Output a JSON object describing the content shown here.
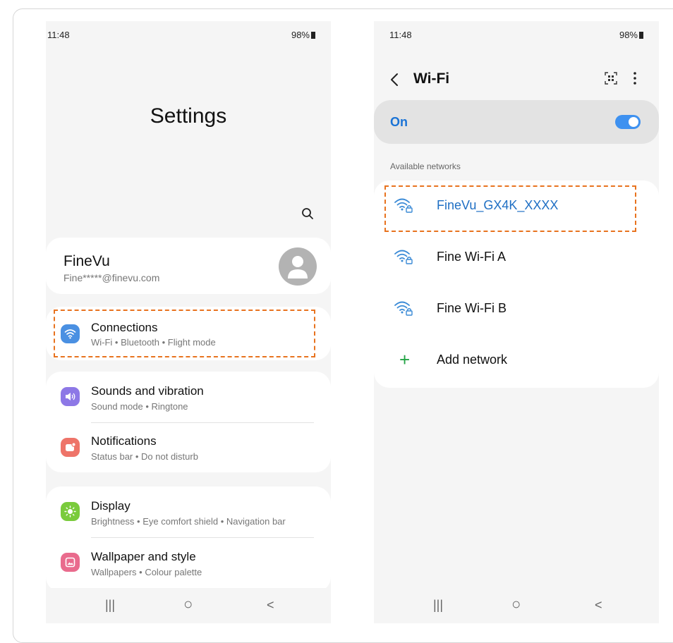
{
  "left": {
    "status": {
      "time": "11:48",
      "battery": "98%"
    },
    "page_title": "Settings",
    "account": {
      "name": "FineVu",
      "email": "Fine*****@finevu.com"
    },
    "items": [
      {
        "title": "Connections",
        "subtitle": "Wi-Fi  •  Bluetooth  •  Flight mode",
        "icon": "wifi-icon",
        "color": "#4a90e2"
      },
      {
        "title": "Sounds and vibration",
        "subtitle": "Sound mode  •  Ringtone",
        "icon": "speaker-icon",
        "color": "#8d78e6"
      },
      {
        "title": "Notifications",
        "subtitle": "Status bar  •  Do not disturb",
        "icon": "notification-icon",
        "color": "#ee7469"
      },
      {
        "title": "Display",
        "subtitle": "Brightness  •  Eye comfort shield  •  Navigation bar",
        "icon": "sun-icon",
        "color": "#7acb3c"
      },
      {
        "title": "Wallpaper and style",
        "subtitle": "Wallpapers  •  Colour palette",
        "icon": "wallpaper-icon",
        "color": "#e96b8d"
      }
    ],
    "nav": {
      "recents": "|||",
      "home": "○",
      "back": "<"
    }
  },
  "right": {
    "status": {
      "time": "11:48",
      "battery": "98%"
    },
    "title": "Wi-Fi",
    "toggle_label": "On",
    "toggle_on": true,
    "section_label": "Available networks",
    "networks": [
      {
        "name": "FineVu_GX4K_XXXX",
        "selected": true
      },
      {
        "name": "Fine Wi-Fi A",
        "selected": false
      },
      {
        "name": "Fine Wi-Fi B",
        "selected": false
      }
    ],
    "add_network": "Add network",
    "nav": {
      "recents": "|||",
      "home": "○",
      "back": "<"
    }
  },
  "colors": {
    "highlight": "#e8731f",
    "accent": "#1a73d6",
    "toggle": "#3e91f0",
    "add": "#22a344"
  }
}
